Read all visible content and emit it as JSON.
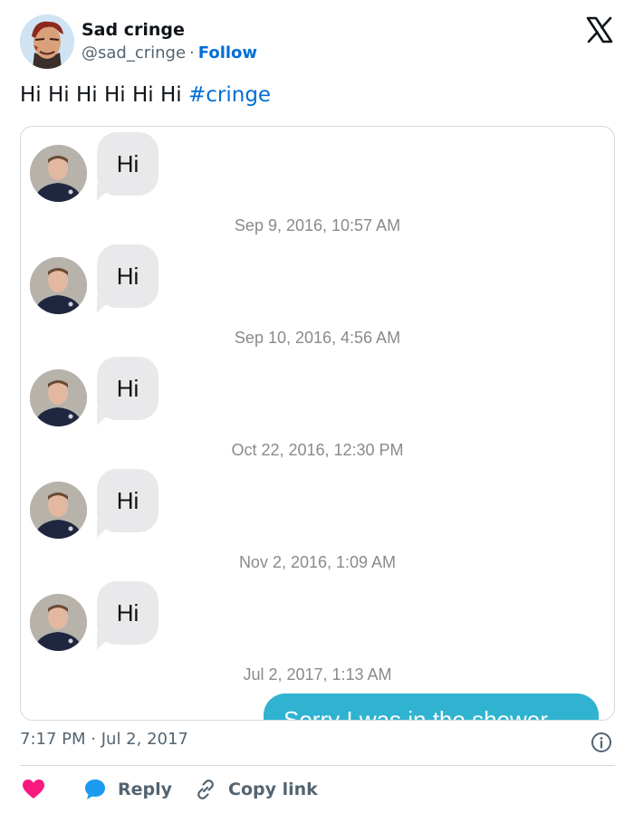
{
  "author": {
    "name": "Sad cringe",
    "handle": "@sad_cringe",
    "separator": "·",
    "follow_label": "Follow"
  },
  "tweet": {
    "text": "Hi Hi Hi Hi Hi Hi",
    "hashtag": "#cringe"
  },
  "media": {
    "messages": [
      {
        "text": "Hi",
        "timestamp": "Sep 9, 2016, 10:57 AM"
      },
      {
        "text": "Hi",
        "timestamp": "Sep 10, 2016, 4:56 AM"
      },
      {
        "text": "Hi",
        "timestamp": "Oct 22, 2016, 12:30 PM"
      },
      {
        "text": "Hi",
        "timestamp": "Nov 2, 2016, 1:09 AM"
      },
      {
        "text": "Hi",
        "timestamp": "Jul 2, 2017, 1:13 AM"
      }
    ],
    "reply_text": "Sorry I was in the shower"
  },
  "footer": {
    "time": "7:17 PM",
    "date": "Jul 2, 2017",
    "separator": "·",
    "reply_label": "Reply",
    "copy_link_label": "Copy link"
  },
  "colors": {
    "link": "#006fd6",
    "like": "#f91880",
    "reply_bubble": "#2fb3d1",
    "incoming_bubble": "#e9e9eb"
  },
  "icons": {
    "logo": "x-logo-icon",
    "like": "heart-icon",
    "reply": "speech-bubble-icon",
    "copy": "link-icon",
    "info": "info-icon"
  }
}
